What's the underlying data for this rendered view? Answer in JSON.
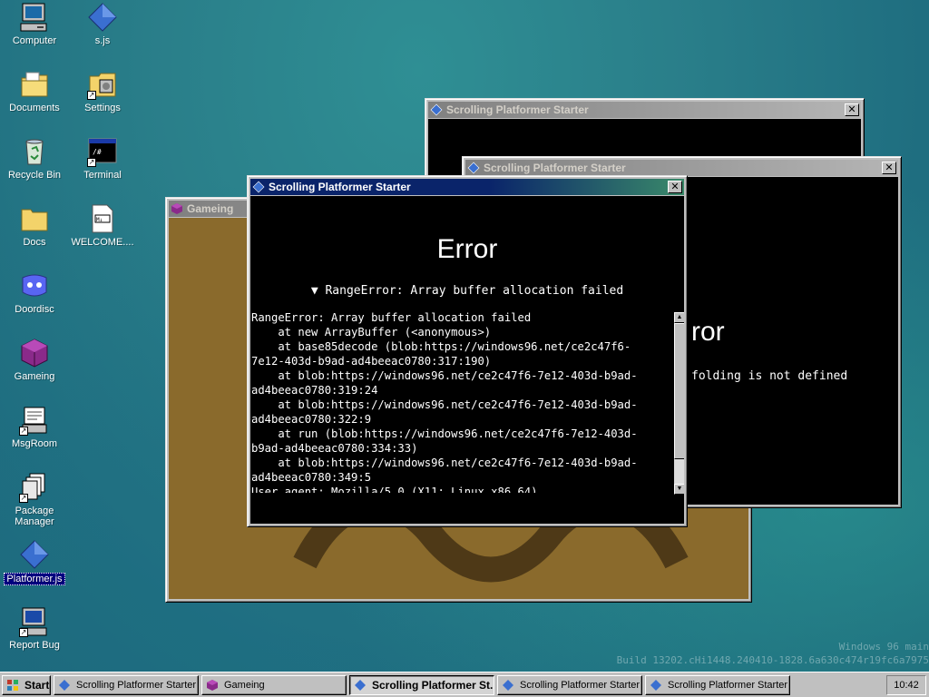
{
  "desktop": {
    "icons": [
      {
        "label": "Computer",
        "icon": "computer-icon"
      },
      {
        "label": "s.js",
        "icon": "js-diamond-icon"
      },
      {
        "label": "Documents",
        "icon": "folder-documents-icon"
      },
      {
        "label": "Settings",
        "icon": "settings-icon"
      },
      {
        "label": "Recycle Bin",
        "icon": "recycle-bin-icon"
      },
      {
        "label": "Terminal",
        "icon": "terminal-icon"
      },
      {
        "label": "Docs",
        "icon": "folder-icon"
      },
      {
        "label": "WELCOME....",
        "icon": "markdown-file-icon"
      },
      {
        "label": "Doordisc",
        "icon": "doordisc-icon"
      },
      {
        "label": "Gameing",
        "icon": "gameing-cube-icon"
      },
      {
        "label": "MsgRoom",
        "icon": "msgroom-icon"
      },
      {
        "label": "Package Manager",
        "icon": "package-manager-icon"
      },
      {
        "label": "Platformer.js",
        "icon": "js-diamond-icon"
      },
      {
        "label": "Report Bug",
        "icon": "report-bug-icon"
      }
    ],
    "watermark": {
      "line1": "Windows 96 main",
      "line2": "Build 13202.cHi1448.240410-1828.6a630c474r19fc6a7975"
    }
  },
  "windows": {
    "gameing": {
      "title": "Gameing"
    },
    "back_error": {
      "title": "Scrolling Platformer Starter"
    },
    "mid_error": {
      "title": "Scrolling Platformer Starter",
      "heading_fragment": "ror",
      "message_fragment": "folding is not defined"
    },
    "front_error": {
      "title": "Scrolling Platformer Starter",
      "heading": "Error",
      "summary": "▼ RangeError: Array buffer allocation failed",
      "stack_lines": [
        "RangeError: Array buffer allocation failed",
        "    at new ArrayBuffer (<anonymous>)",
        "    at base85decode (blob:https://windows96.net/ce2c47f6-",
        "7e12-403d-b9ad-ad4beeac0780:317:190)",
        "    at blob:https://windows96.net/ce2c47f6-7e12-403d-b9ad-",
        "ad4beeac0780:319:24",
        "    at blob:https://windows96.net/ce2c47f6-7e12-403d-b9ad-",
        "ad4beeac0780:322:9",
        "    at run (blob:https://windows96.net/ce2c47f6-7e12-403d-",
        "b9ad-ad4beeac0780:334:33)",
        "    at blob:https://windows96.net/ce2c47f6-7e12-403d-b9ad-",
        "ad4beeac0780:349:5",
        "User agent: Mozilla/5.0 (X11; Linux x86_64)"
      ]
    }
  },
  "taskbar": {
    "start_label": "Start",
    "tasks": [
      {
        "label": "Scrolling Platformer Starter",
        "icon": "js-diamond-icon"
      },
      {
        "label": "Gameing",
        "icon": "gameing-cube-icon"
      },
      {
        "label": "Scrolling Platformer St...",
        "icon": "js-diamond-icon"
      },
      {
        "label": "Scrolling Platformer Starter",
        "icon": "js-diamond-icon"
      },
      {
        "label": "Scrolling Platformer Starter",
        "icon": "js-diamond-icon"
      }
    ],
    "clock": "10:42"
  },
  "colors": {
    "titlebar_active": "#000080",
    "titlebar_inactive": "#808080",
    "window_face": "#c0c0c0",
    "gameing_bg": "#8a6a2c",
    "error_bg": "#000000"
  }
}
